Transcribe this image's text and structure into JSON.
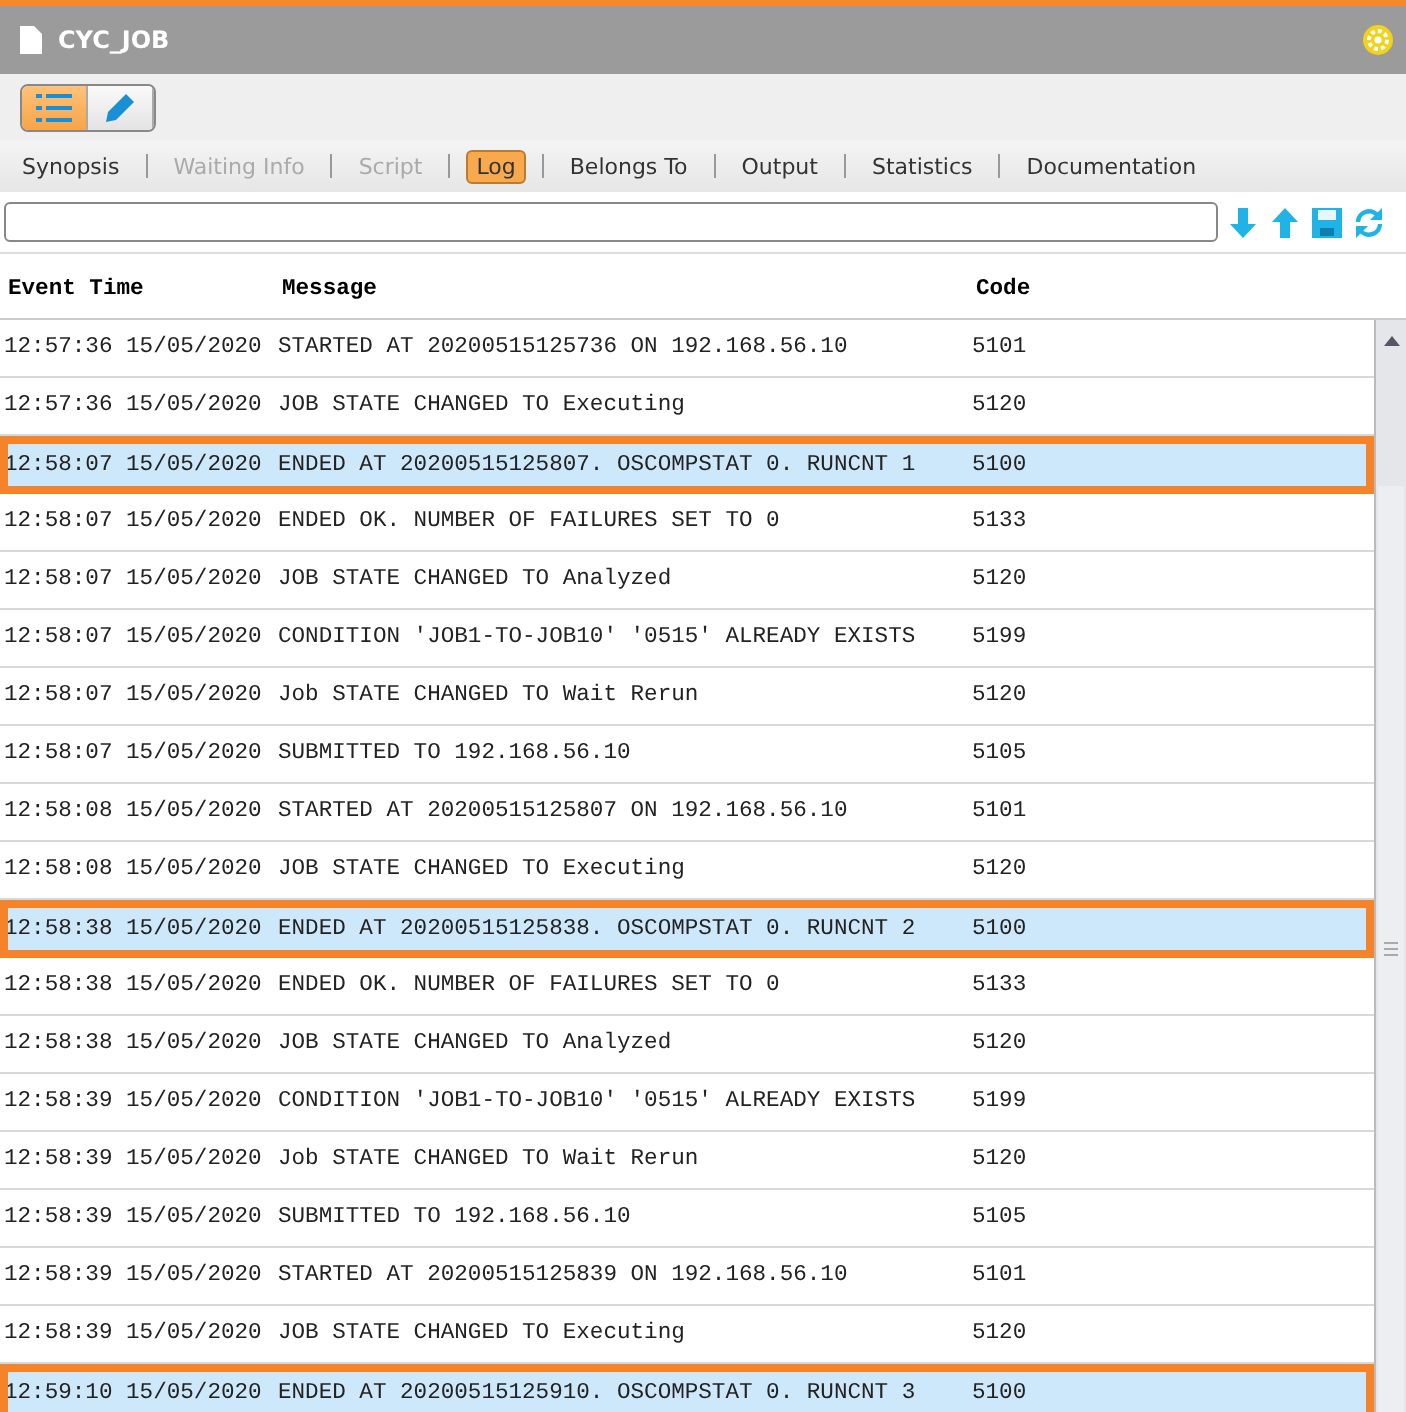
{
  "window": {
    "title": "CYC_JOB"
  },
  "view_toggle": [
    {
      "kind": "list",
      "selected": true
    },
    {
      "kind": "edit",
      "selected": false
    }
  ],
  "tabs": [
    {
      "label": "Synopsis",
      "selected": false,
      "disabled": false
    },
    {
      "label": "Waiting Info",
      "selected": false,
      "disabled": true
    },
    {
      "label": "Script",
      "selected": false,
      "disabled": true
    },
    {
      "label": "Log",
      "selected": true,
      "disabled": false
    },
    {
      "label": "Belongs To",
      "selected": false,
      "disabled": false
    },
    {
      "label": "Output",
      "selected": false,
      "disabled": false
    },
    {
      "label": "Statistics",
      "selected": false,
      "disabled": false
    },
    {
      "label": "Documentation",
      "selected": false,
      "disabled": false
    }
  ],
  "toolbar": [
    {
      "kind": "down"
    },
    {
      "kind": "up"
    },
    {
      "kind": "save"
    },
    {
      "kind": "refresh"
    }
  ],
  "table": {
    "columns": [
      "Event Time",
      "Message",
      "Code"
    ],
    "rows": [
      {
        "time": "12:57:36 15/05/2020",
        "message": "STARTED AT 20200515125736 ON 192.168.56.10",
        "code": "5101",
        "highlighted": false
      },
      {
        "time": "12:57:36 15/05/2020",
        "message": "JOB STATE CHANGED TO Executing",
        "code": "5120",
        "highlighted": false
      },
      {
        "time": "12:58:07 15/05/2020",
        "message": "ENDED AT 20200515125807. OSCOMPSTAT 0. RUNCNT 1",
        "code": "5100",
        "highlighted": true
      },
      {
        "time": "12:58:07 15/05/2020",
        "message": "ENDED OK. NUMBER OF FAILURES SET TO 0",
        "code": "5133",
        "highlighted": false
      },
      {
        "time": "12:58:07 15/05/2020",
        "message": "JOB STATE CHANGED TO Analyzed",
        "code": "5120",
        "highlighted": false
      },
      {
        "time": "12:58:07 15/05/2020",
        "message": "CONDITION 'JOB1-TO-JOB10' '0515' ALREADY EXISTS",
        "code": "5199",
        "highlighted": false
      },
      {
        "time": "12:58:07 15/05/2020",
        "message": "Job STATE CHANGED TO Wait Rerun",
        "code": "5120",
        "highlighted": false
      },
      {
        "time": "12:58:07 15/05/2020",
        "message": "SUBMITTED TO 192.168.56.10",
        "code": "5105",
        "highlighted": false
      },
      {
        "time": "12:58:08 15/05/2020",
        "message": "STARTED AT 20200515125807 ON 192.168.56.10",
        "code": "5101",
        "highlighted": false
      },
      {
        "time": "12:58:08 15/05/2020",
        "message": "JOB STATE CHANGED TO Executing",
        "code": "5120",
        "highlighted": false
      },
      {
        "time": "12:58:38 15/05/2020",
        "message": "ENDED AT 20200515125838. OSCOMPSTAT 0. RUNCNT 2",
        "code": "5100",
        "highlighted": true
      },
      {
        "time": "12:58:38 15/05/2020",
        "message": "ENDED OK. NUMBER OF FAILURES SET TO 0",
        "code": "5133",
        "highlighted": false
      },
      {
        "time": "12:58:38 15/05/2020",
        "message": "JOB STATE CHANGED TO Analyzed",
        "code": "5120",
        "highlighted": false
      },
      {
        "time": "12:58:39 15/05/2020",
        "message": "CONDITION 'JOB1-TO-JOB10' '0515' ALREADY EXISTS",
        "code": "5199",
        "highlighted": false
      },
      {
        "time": "12:58:39 15/05/2020",
        "message": "Job STATE CHANGED TO Wait Rerun",
        "code": "5120",
        "highlighted": false
      },
      {
        "time": "12:58:39 15/05/2020",
        "message": "SUBMITTED TO 192.168.56.10",
        "code": "5105",
        "highlighted": false
      },
      {
        "time": "12:58:39 15/05/2020",
        "message": "STARTED AT 20200515125839 ON 192.168.56.10",
        "code": "5101",
        "highlighted": false
      },
      {
        "time": "12:58:39 15/05/2020",
        "message": "JOB STATE CHANGED TO Executing",
        "code": "5120",
        "highlighted": false
      },
      {
        "time": "12:59:10 15/05/2020",
        "message": "ENDED AT 20200515125910. OSCOMPSTAT 0. RUNCNT 3",
        "code": "5100",
        "highlighted": true
      }
    ]
  }
}
